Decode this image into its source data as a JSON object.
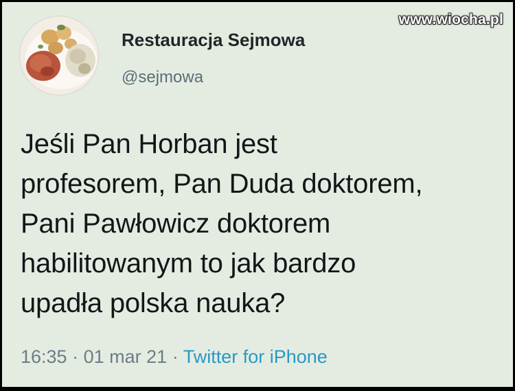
{
  "watermark": "www.wiocha.pl",
  "author": {
    "name": "Restauracja Sejmowa",
    "handle": "@sejmowa",
    "avatar_icon": "food-plate-avatar"
  },
  "tweet": {
    "lines": [
      "Jeśli Pan Horban jest",
      "profesorem, Pan Duda doktorem,",
      "Pani Pawłowicz doktorem",
      "habilitowanym to jak bardzo",
      "upadła polska nauka?"
    ]
  },
  "meta": {
    "time": "16:35",
    "separator": "·",
    "date": "01 mar 21",
    "source": "Twitter for iPhone"
  },
  "colors": {
    "background": "#e4ece1",
    "name": "#1f2629",
    "handle": "#5b6d78",
    "text": "#121618",
    "meta": "#6a7d87",
    "source_link": "#2a98c4"
  }
}
